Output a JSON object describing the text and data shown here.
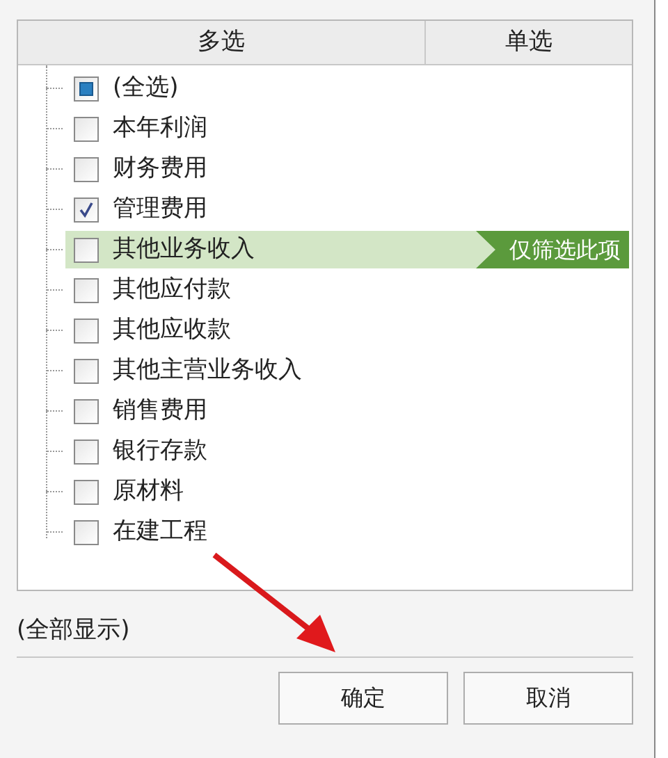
{
  "tabs": [
    {
      "label": "多选"
    },
    {
      "label": "单选"
    }
  ],
  "items": [
    {
      "label": "(全选)",
      "checked": false,
      "indeterminate": true,
      "hovered": false
    },
    {
      "label": "本年利润",
      "checked": false,
      "indeterminate": false,
      "hovered": false
    },
    {
      "label": "财务费用",
      "checked": false,
      "indeterminate": false,
      "hovered": false
    },
    {
      "label": "管理费用",
      "checked": true,
      "indeterminate": false,
      "hovered": false
    },
    {
      "label": "其他业务收入",
      "checked": false,
      "indeterminate": false,
      "hovered": true,
      "action": "仅筛选此项"
    },
    {
      "label": "其他应付款",
      "checked": false,
      "indeterminate": false,
      "hovered": false
    },
    {
      "label": "其他应收款",
      "checked": false,
      "indeterminate": false,
      "hovered": false
    },
    {
      "label": "其他主营业务收入",
      "checked": false,
      "indeterminate": false,
      "hovered": false
    },
    {
      "label": "销售费用",
      "checked": false,
      "indeterminate": false,
      "hovered": false
    },
    {
      "label": "银行存款",
      "checked": false,
      "indeterminate": false,
      "hovered": false
    },
    {
      "label": "原材料",
      "checked": false,
      "indeterminate": false,
      "hovered": false
    },
    {
      "label": "在建工程",
      "checked": false,
      "indeterminate": false,
      "hovered": false
    }
  ],
  "status": "(全部显示)",
  "buttons": [
    "确定",
    "取消"
  ]
}
